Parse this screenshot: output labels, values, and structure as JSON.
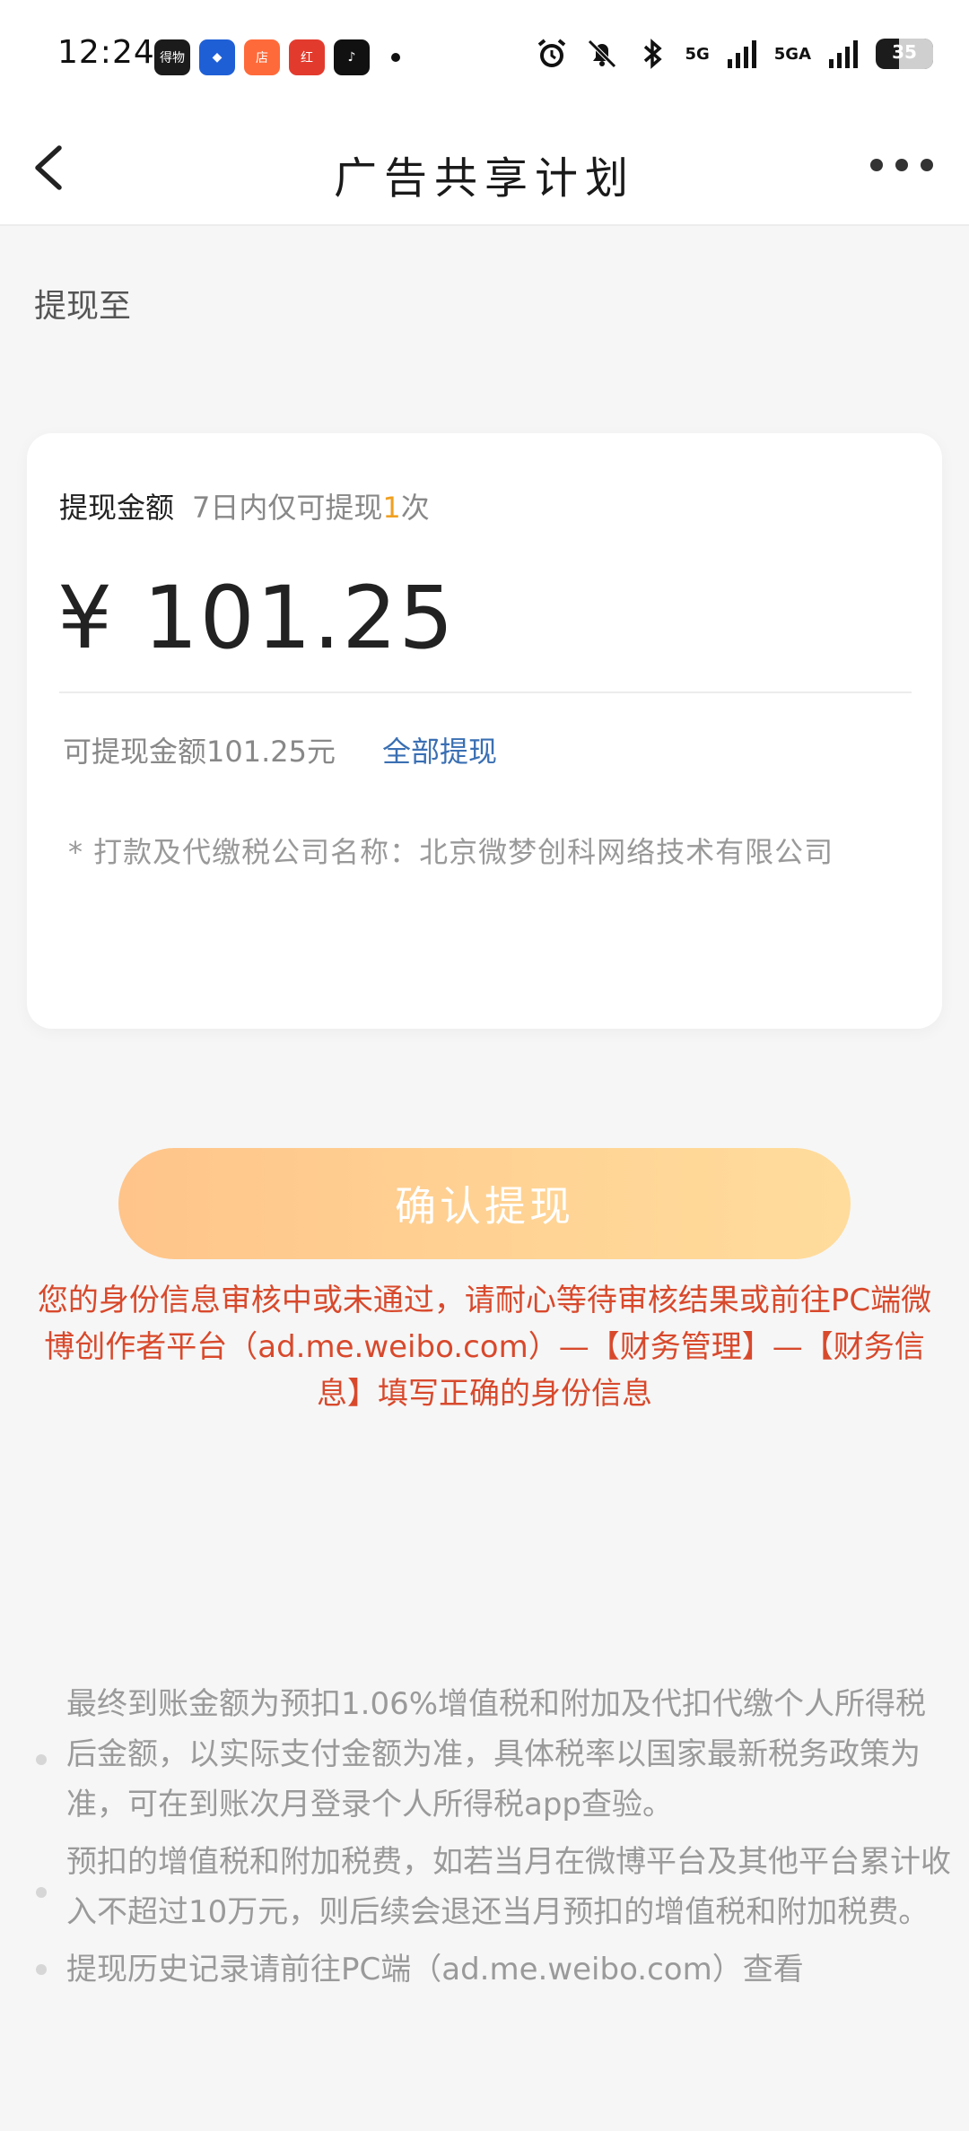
{
  "status_bar": {
    "time": "12:24",
    "app_icons": [
      {
        "name": "dewu-app-icon",
        "label": "得物",
        "color": "#1b1b1b"
      },
      {
        "name": "bank-app-icon",
        "label": "◆",
        "color": "#1f5fd6"
      },
      {
        "name": "shop-app-icon",
        "label": "店",
        "color": "#ff6a3a"
      },
      {
        "name": "redbag-app-icon",
        "label": "红",
        "color": "#e23b2e"
      },
      {
        "name": "tiktok-app-icon",
        "label": "♪",
        "color": "#111111"
      }
    ],
    "signal_1": "5G",
    "signal_2": "5GA",
    "battery": "35"
  },
  "nav": {
    "title": "广告共享计划"
  },
  "withdraw_to_label": "提现至",
  "card": {
    "amount_label": "提现金额",
    "limit_prefix": "7日内仅可提现",
    "limit_count": "1",
    "limit_suffix": "次",
    "amount_value": "¥ 101.25",
    "available_text": "可提现金额101.25元",
    "withdraw_all": "全部提现",
    "note": "* 打款及代缴税公司名称：北京微梦创科网络技术有限公司"
  },
  "confirm_button": "确认提现",
  "warning_text": "您的身份信息审核中或未通过，请耐心等待审核结果或前往PC端微博创作者平台（ad.me.weibo.com）—【财务管理】—【财务信息】填写正确的身份信息",
  "tips": [
    "最终到账金额为预扣1.06%增值税和附加及代扣代缴个人所得税后金额，以实际支付金额为准，具体税率以国家最新税务政策为准，可在到账次月登录个人所得税app查验。",
    "预扣的增值税和附加税费，如若当月在微博平台及其他平台累计收入不超过10万元，则后续会退还当月预扣的增值税和附加税费。",
    "提现历史记录请前往PC端（ad.me.weibo.com）查看"
  ]
}
